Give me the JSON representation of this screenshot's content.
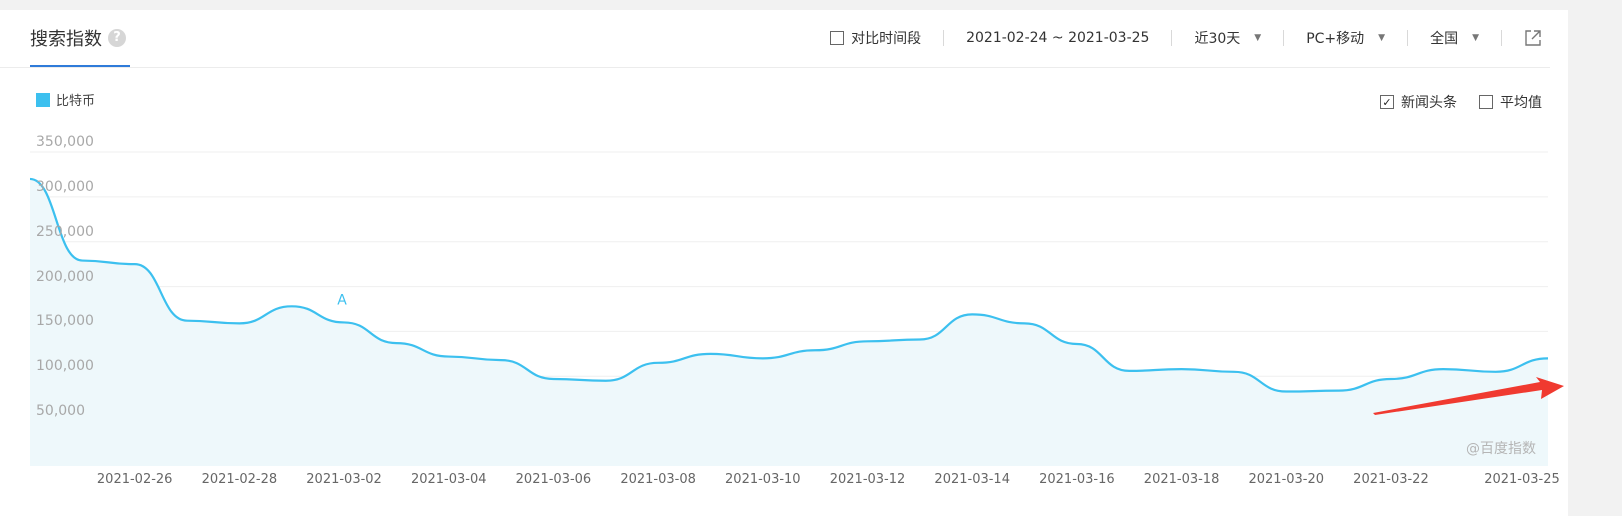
{
  "header": {
    "title": "搜索指数",
    "help_icon": "question-icon",
    "compare_label": "对比时间段",
    "date_range": "2021-02-24 ~ 2021-03-25",
    "period": "近30天",
    "device": "PC+移动",
    "region": "全国",
    "export_icon": "external-link-icon"
  },
  "options": {
    "news_label": "新闻头条",
    "news_checked": true,
    "avg_label": "平均值",
    "avg_checked": false
  },
  "watermark": "@百度指数",
  "colors": {
    "series": "#3cc0ef",
    "area": "#eef8fb",
    "arrow": "#f03a30",
    "accent": "#2f7bd9"
  },
  "chart_data": {
    "type": "area",
    "title": "",
    "xlabel": "",
    "ylabel": "",
    "ylim": [
      0,
      350000
    ],
    "yticks": [
      "350,000",
      "300,000",
      "250,000",
      "200,000",
      "150,000",
      "100,000",
      "50,000"
    ],
    "ytick_values": [
      350000,
      300000,
      250000,
      200000,
      150000,
      100000,
      50000
    ],
    "x_tick_labels": [
      "2021-02-26",
      "2021-02-28",
      "2021-03-02",
      "2021-03-04",
      "2021-03-06",
      "2021-03-08",
      "2021-03-10",
      "2021-03-12",
      "2021-03-14",
      "2021-03-16",
      "2021-03-18",
      "2021-03-20",
      "2021-03-22",
      "2021-03-25"
    ],
    "x": [
      "2021-02-24",
      "2021-02-25",
      "2021-02-26",
      "2021-02-27",
      "2021-02-28",
      "2021-03-01",
      "2021-03-02",
      "2021-03-03",
      "2021-03-04",
      "2021-03-05",
      "2021-03-06",
      "2021-03-07",
      "2021-03-08",
      "2021-03-09",
      "2021-03-10",
      "2021-03-11",
      "2021-03-12",
      "2021-03-13",
      "2021-03-14",
      "2021-03-15",
      "2021-03-16",
      "2021-03-17",
      "2021-03-18",
      "2021-03-19",
      "2021-03-20",
      "2021-03-21",
      "2021-03-22",
      "2021-03-23",
      "2021-03-24",
      "2021-03-25"
    ],
    "series": [
      {
        "name": "比特币",
        "values": [
          320000,
          229000,
          225000,
          162000,
          159000,
          178000,
          160000,
          137000,
          122000,
          118000,
          97000,
          95000,
          115000,
          125000,
          120000,
          129000,
          139000,
          141000,
          169000,
          159000,
          136000,
          106000,
          108000,
          105000,
          83000,
          84000,
          97000,
          108000,
          105000,
          120000
        ]
      }
    ],
    "annotations": [
      {
        "label": "A",
        "x": "2021-03-02"
      }
    ],
    "grid": true,
    "legend_position": "top-left"
  }
}
